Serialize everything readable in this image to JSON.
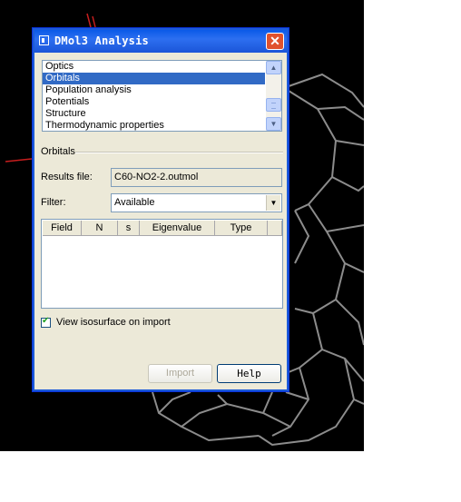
{
  "dialog": {
    "title": "DMol3 Analysis",
    "close_symbol": "✕",
    "list": {
      "items": [
        "Optics",
        "Orbitals",
        "Population analysis",
        "Potentials",
        "Structure",
        "Thermodynamic properties"
      ],
      "selected": "Orbitals"
    },
    "section_title": "Orbitals",
    "results_file": {
      "label": "Results file:",
      "value": "C60-NO2-2.outmol"
    },
    "filter": {
      "label": "Filter:",
      "value": "Available"
    },
    "table": {
      "columns": [
        "Field",
        "N",
        "s",
        "Eigenvalue",
        "Type"
      ],
      "rows": []
    },
    "view_isosurface": {
      "label": "View isosurface on import",
      "checked": true
    },
    "buttons": {
      "import": "Import",
      "help": "Help"
    }
  },
  "colors": {
    "titlebar": "#0a5ae8",
    "selection": "#316ac5",
    "viewport_bg": "#000000",
    "mesh": "#8c8c8c",
    "bond": "#c81e1e"
  }
}
